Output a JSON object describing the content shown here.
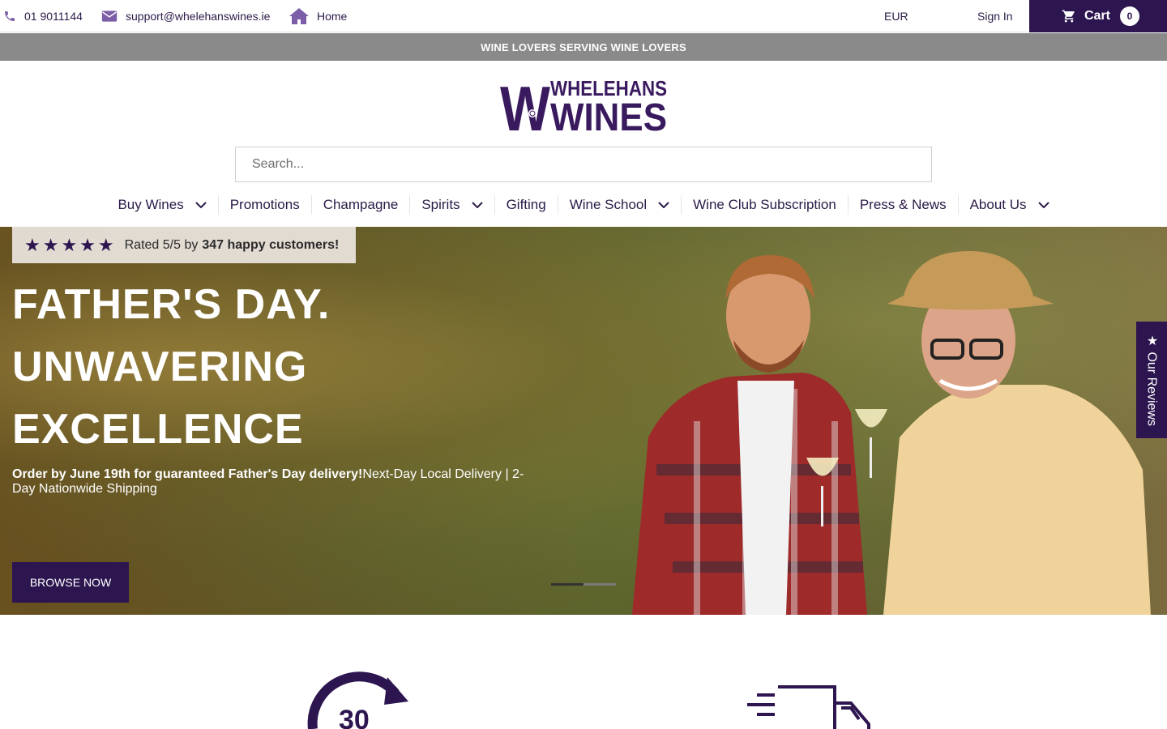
{
  "topbar": {
    "phone": "01 9011144",
    "email": "support@whelehanswines.ie",
    "home": "Home",
    "currency": "EUR",
    "sign_in": "Sign In",
    "cart_label": "Cart",
    "cart_count": "0"
  },
  "announcement": "WINE LOVERS SERVING WINE LOVERS",
  "logo": {
    "line1": "WHELEHANS",
    "line2": "WINES",
    "monogram": "W"
  },
  "search": {
    "placeholder": "Search..."
  },
  "nav": {
    "items": [
      {
        "label": "Buy Wines",
        "dropdown": true
      },
      {
        "label": "Promotions",
        "dropdown": false
      },
      {
        "label": "Champagne",
        "dropdown": false
      },
      {
        "label": "Spirits",
        "dropdown": true
      },
      {
        "label": "Gifting",
        "dropdown": false
      },
      {
        "label": "Wine School",
        "dropdown": true
      },
      {
        "label": "Wine Club Subscription",
        "dropdown": false
      },
      {
        "label": "Press & News",
        "dropdown": false
      },
      {
        "label": "About Us",
        "dropdown": true
      }
    ]
  },
  "hero": {
    "rating_stars": "★★★★★",
    "rating_text": "Rated 5/5 by",
    "rating_bold": "347 happy customers!",
    "title_lines": [
      "FATHER'S DAY.",
      "UNWAVERING",
      "EXCELLENCE"
    ],
    "subtitle_bold": "Order by June 19th for guaranteed Father's Day delivery!",
    "subtitle_rest": "Next-Day Local Delivery | 2-Day Nationwide Shipping",
    "cta": "BROWSE NOW"
  },
  "reviews_tab": "★ Our Reviews",
  "features": {
    "icon_1_text": "30",
    "icon_1_name": "30-day-returns-icon",
    "icon_2_name": "delivery-truck-icon"
  },
  "colors": {
    "brand": "#2d1650",
    "announcement_bg": "#8a8a8a"
  }
}
